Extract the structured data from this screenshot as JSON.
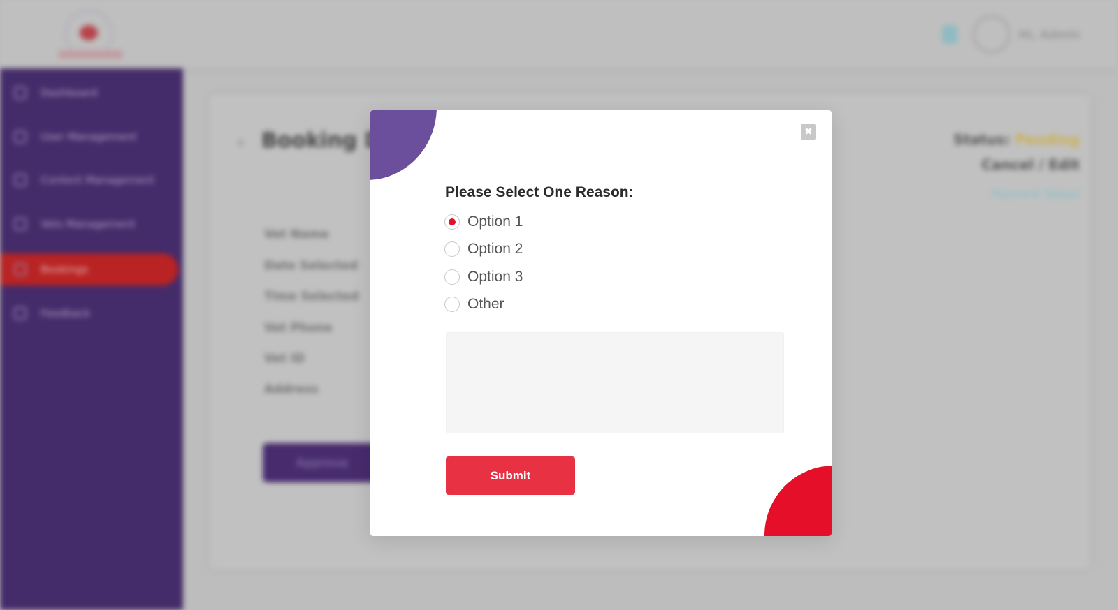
{
  "header": {
    "user_name": "Hi, Admin"
  },
  "sidebar": {
    "items": [
      {
        "label": "Dashboard",
        "icon": "dashboard-icon"
      },
      {
        "label": "User Management",
        "icon": "users-icon"
      },
      {
        "label": "Content Management",
        "icon": "content-icon"
      },
      {
        "label": "Vets Management",
        "icon": "vet-icon"
      },
      {
        "label": "Bookings",
        "icon": "calendar-icon",
        "active": true
      },
      {
        "label": "Feedback",
        "icon": "feedback-icon"
      }
    ]
  },
  "page": {
    "title": "Booking Details",
    "status_label": "Status:",
    "status_value": "Pending",
    "cancel_label": "Cancel / Edit",
    "payment_link": "Payment Status",
    "detail_labels": [
      "Vet Name",
      "Date Selected",
      "Time Selected",
      "Vet Phone",
      "Vet ID",
      "Address"
    ],
    "approve_label": "Approve"
  },
  "modal": {
    "close_glyph": "✖",
    "question": "Please Select One Reason:",
    "options": [
      {
        "label": "Option 1",
        "selected": true
      },
      {
        "label": "Option 2",
        "selected": false
      },
      {
        "label": "Option 3",
        "selected": false
      },
      {
        "label": "Other",
        "selected": false
      }
    ],
    "reason_value": "",
    "submit_label": "Submit"
  },
  "colors": {
    "sidebar_bg": "#331460",
    "active_item": "#c10a0a",
    "accent_red": "#e50f2a",
    "submit_red": "#e83244",
    "accent_purple": "#6c4f9c"
  }
}
